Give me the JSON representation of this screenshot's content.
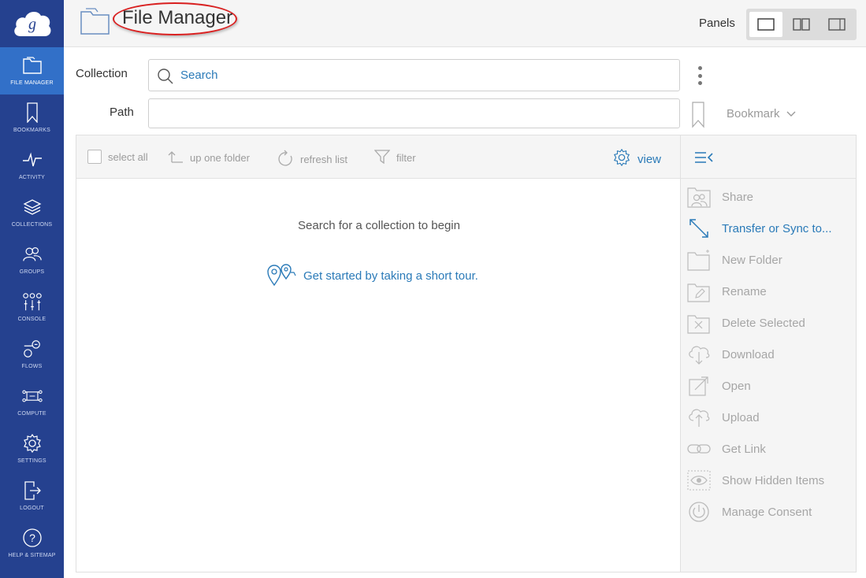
{
  "sidebar": {
    "items": [
      {
        "label": "FILE MANAGER",
        "icon": "folder-icon",
        "active": true
      },
      {
        "label": "BOOKMARKS",
        "icon": "bookmark-icon"
      },
      {
        "label": "ACTIVITY",
        "icon": "activity-icon"
      },
      {
        "label": "COLLECTIONS",
        "icon": "collections-icon"
      },
      {
        "label": "GROUPS",
        "icon": "groups-icon"
      },
      {
        "label": "CONSOLE",
        "icon": "console-icon"
      },
      {
        "label": "FLOWS",
        "icon": "flows-icon"
      },
      {
        "label": "COMPUTE",
        "icon": "compute-icon"
      },
      {
        "label": "SETTINGS",
        "icon": "settings-icon"
      },
      {
        "label": "LOGOUT",
        "icon": "logout-icon"
      },
      {
        "label": "HELP & SITEMAP",
        "icon": "help-icon"
      }
    ]
  },
  "header": {
    "title": "File Manager",
    "panels_label": "Panels"
  },
  "collection": {
    "label": "Collection",
    "search_placeholder": "Search"
  },
  "path": {
    "label": "Path",
    "value": "",
    "bookmark_label": "Bookmark"
  },
  "toolbar": {
    "select_all": "select all",
    "up_one_folder": "up one folder",
    "refresh_list": "refresh list",
    "filter": "filter",
    "view": "view"
  },
  "main": {
    "empty_message": "Search for a collection to begin",
    "tour_link": "Get started by taking a short tour."
  },
  "actions": [
    {
      "label": "Share",
      "icon": "share-icon",
      "enabled": false
    },
    {
      "label": "Transfer or Sync to...",
      "icon": "transfer-icon",
      "enabled": true
    },
    {
      "label": "New Folder",
      "icon": "new-folder-icon",
      "enabled": false
    },
    {
      "label": "Rename",
      "icon": "rename-icon",
      "enabled": false
    },
    {
      "label": "Delete Selected",
      "icon": "delete-icon",
      "enabled": false
    },
    {
      "label": "Download",
      "icon": "download-icon",
      "enabled": false
    },
    {
      "label": "Open",
      "icon": "open-icon",
      "enabled": false
    },
    {
      "label": "Upload",
      "icon": "upload-icon",
      "enabled": false
    },
    {
      "label": "Get Link",
      "icon": "link-icon",
      "enabled": false
    },
    {
      "label": "Show Hidden Items",
      "icon": "eye-icon",
      "enabled": false
    },
    {
      "label": "Manage Consent",
      "icon": "power-icon",
      "enabled": false
    }
  ],
  "colors": {
    "sidebar_bg": "#25418f",
    "sidebar_active": "#3270c8",
    "accent": "#2a7ab8",
    "annotation": "#d92020"
  }
}
